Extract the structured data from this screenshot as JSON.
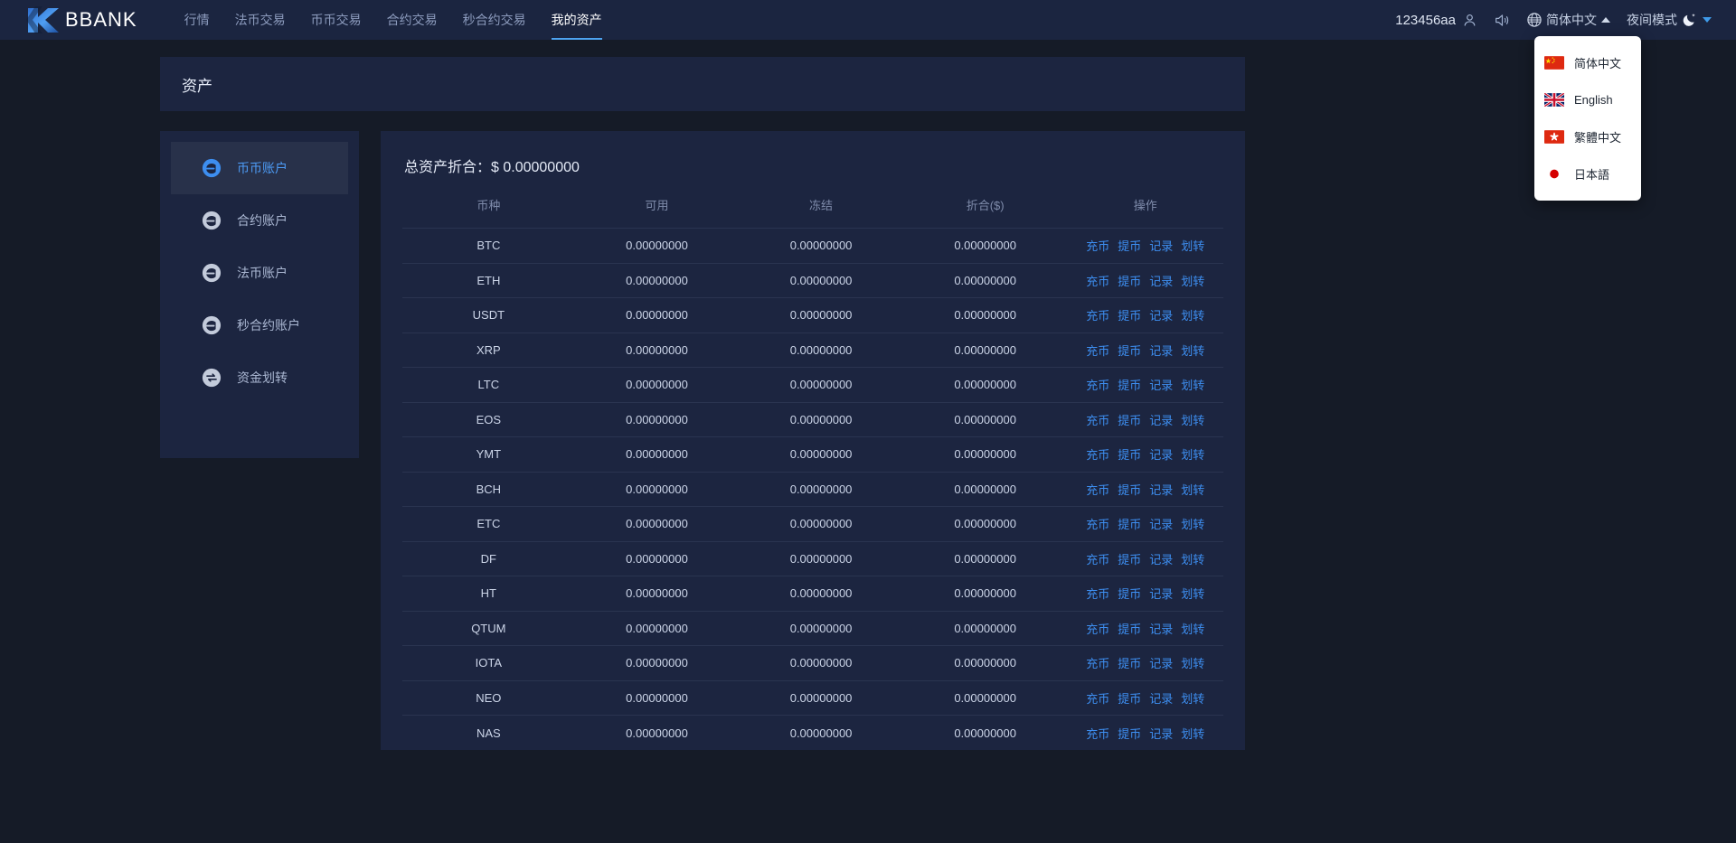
{
  "brand": {
    "logo_text": "BBANK",
    "logo_mark": "k-logo-icon"
  },
  "nav": {
    "items": [
      {
        "label": "行情",
        "active": false
      },
      {
        "label": "法币交易",
        "active": false
      },
      {
        "label": "币币交易",
        "active": false
      },
      {
        "label": "合约交易",
        "active": false
      },
      {
        "label": "秒合约交易",
        "active": false
      },
      {
        "label": "我的资产",
        "active": true
      }
    ]
  },
  "header_right": {
    "username": "123456aa",
    "user_icon": "user-icon",
    "sound_icon": "sound-icon",
    "globe_icon": "globe-icon",
    "language_label": "简体中文",
    "language_caret": "caret-up-icon",
    "night_mode_label": "夜间模式",
    "moon_icon": "moon-icon",
    "night_caret": "caret-down-icon"
  },
  "language_menu": {
    "open": true,
    "items": [
      {
        "label": "简体中文",
        "flag": "flag-cn"
      },
      {
        "label": "English",
        "flag": "flag-gb"
      },
      {
        "label": "繁體中文",
        "flag": "flag-hk"
      },
      {
        "label": "日本語",
        "flag": "flag-jp"
      }
    ]
  },
  "page": {
    "title": "资产"
  },
  "sidebar": {
    "items": [
      {
        "label": "币币账户",
        "icon": "coin-account-icon",
        "active": true
      },
      {
        "label": "合约账户",
        "icon": "contract-account-icon",
        "active": false
      },
      {
        "label": "法币账户",
        "icon": "fiat-account-icon",
        "active": false
      },
      {
        "label": "秒合约账户",
        "icon": "second-contract-account-icon",
        "active": false
      },
      {
        "label": "资金划转",
        "icon": "transfer-icon",
        "active": false
      }
    ]
  },
  "assets": {
    "total_label": "总资产折合：",
    "total_value": "$ 0.00000000",
    "columns": [
      "币种",
      "可用",
      "冻结",
      "折合($)",
      "操作"
    ],
    "actions": [
      "充币",
      "提币",
      "记录",
      "划转"
    ],
    "rows": [
      {
        "coin": "BTC",
        "available": "0.00000000",
        "frozen": "0.00000000",
        "converted": "0.00000000"
      },
      {
        "coin": "ETH",
        "available": "0.00000000",
        "frozen": "0.00000000",
        "converted": "0.00000000"
      },
      {
        "coin": "USDT",
        "available": "0.00000000",
        "frozen": "0.00000000",
        "converted": "0.00000000"
      },
      {
        "coin": "XRP",
        "available": "0.00000000",
        "frozen": "0.00000000",
        "converted": "0.00000000"
      },
      {
        "coin": "LTC",
        "available": "0.00000000",
        "frozen": "0.00000000",
        "converted": "0.00000000"
      },
      {
        "coin": "EOS",
        "available": "0.00000000",
        "frozen": "0.00000000",
        "converted": "0.00000000"
      },
      {
        "coin": "YMT",
        "available": "0.00000000",
        "frozen": "0.00000000",
        "converted": "0.00000000"
      },
      {
        "coin": "BCH",
        "available": "0.00000000",
        "frozen": "0.00000000",
        "converted": "0.00000000"
      },
      {
        "coin": "ETC",
        "available": "0.00000000",
        "frozen": "0.00000000",
        "converted": "0.00000000"
      },
      {
        "coin": "DF",
        "available": "0.00000000",
        "frozen": "0.00000000",
        "converted": "0.00000000"
      },
      {
        "coin": "HT",
        "available": "0.00000000",
        "frozen": "0.00000000",
        "converted": "0.00000000"
      },
      {
        "coin": "QTUM",
        "available": "0.00000000",
        "frozen": "0.00000000",
        "converted": "0.00000000"
      },
      {
        "coin": "IOTA",
        "available": "0.00000000",
        "frozen": "0.00000000",
        "converted": "0.00000000"
      },
      {
        "coin": "NEO",
        "available": "0.00000000",
        "frozen": "0.00000000",
        "converted": "0.00000000"
      },
      {
        "coin": "NAS",
        "available": "0.00000000",
        "frozen": "0.00000000",
        "converted": "0.00000000"
      }
    ]
  },
  "colors": {
    "page_bg": "#151b27",
    "panel_bg": "#1c2540",
    "header_bg": "#1b2540",
    "accent_blue": "#3d8ef0",
    "active_underline": "#4da3f0",
    "muted_text": "#7f8cab"
  }
}
